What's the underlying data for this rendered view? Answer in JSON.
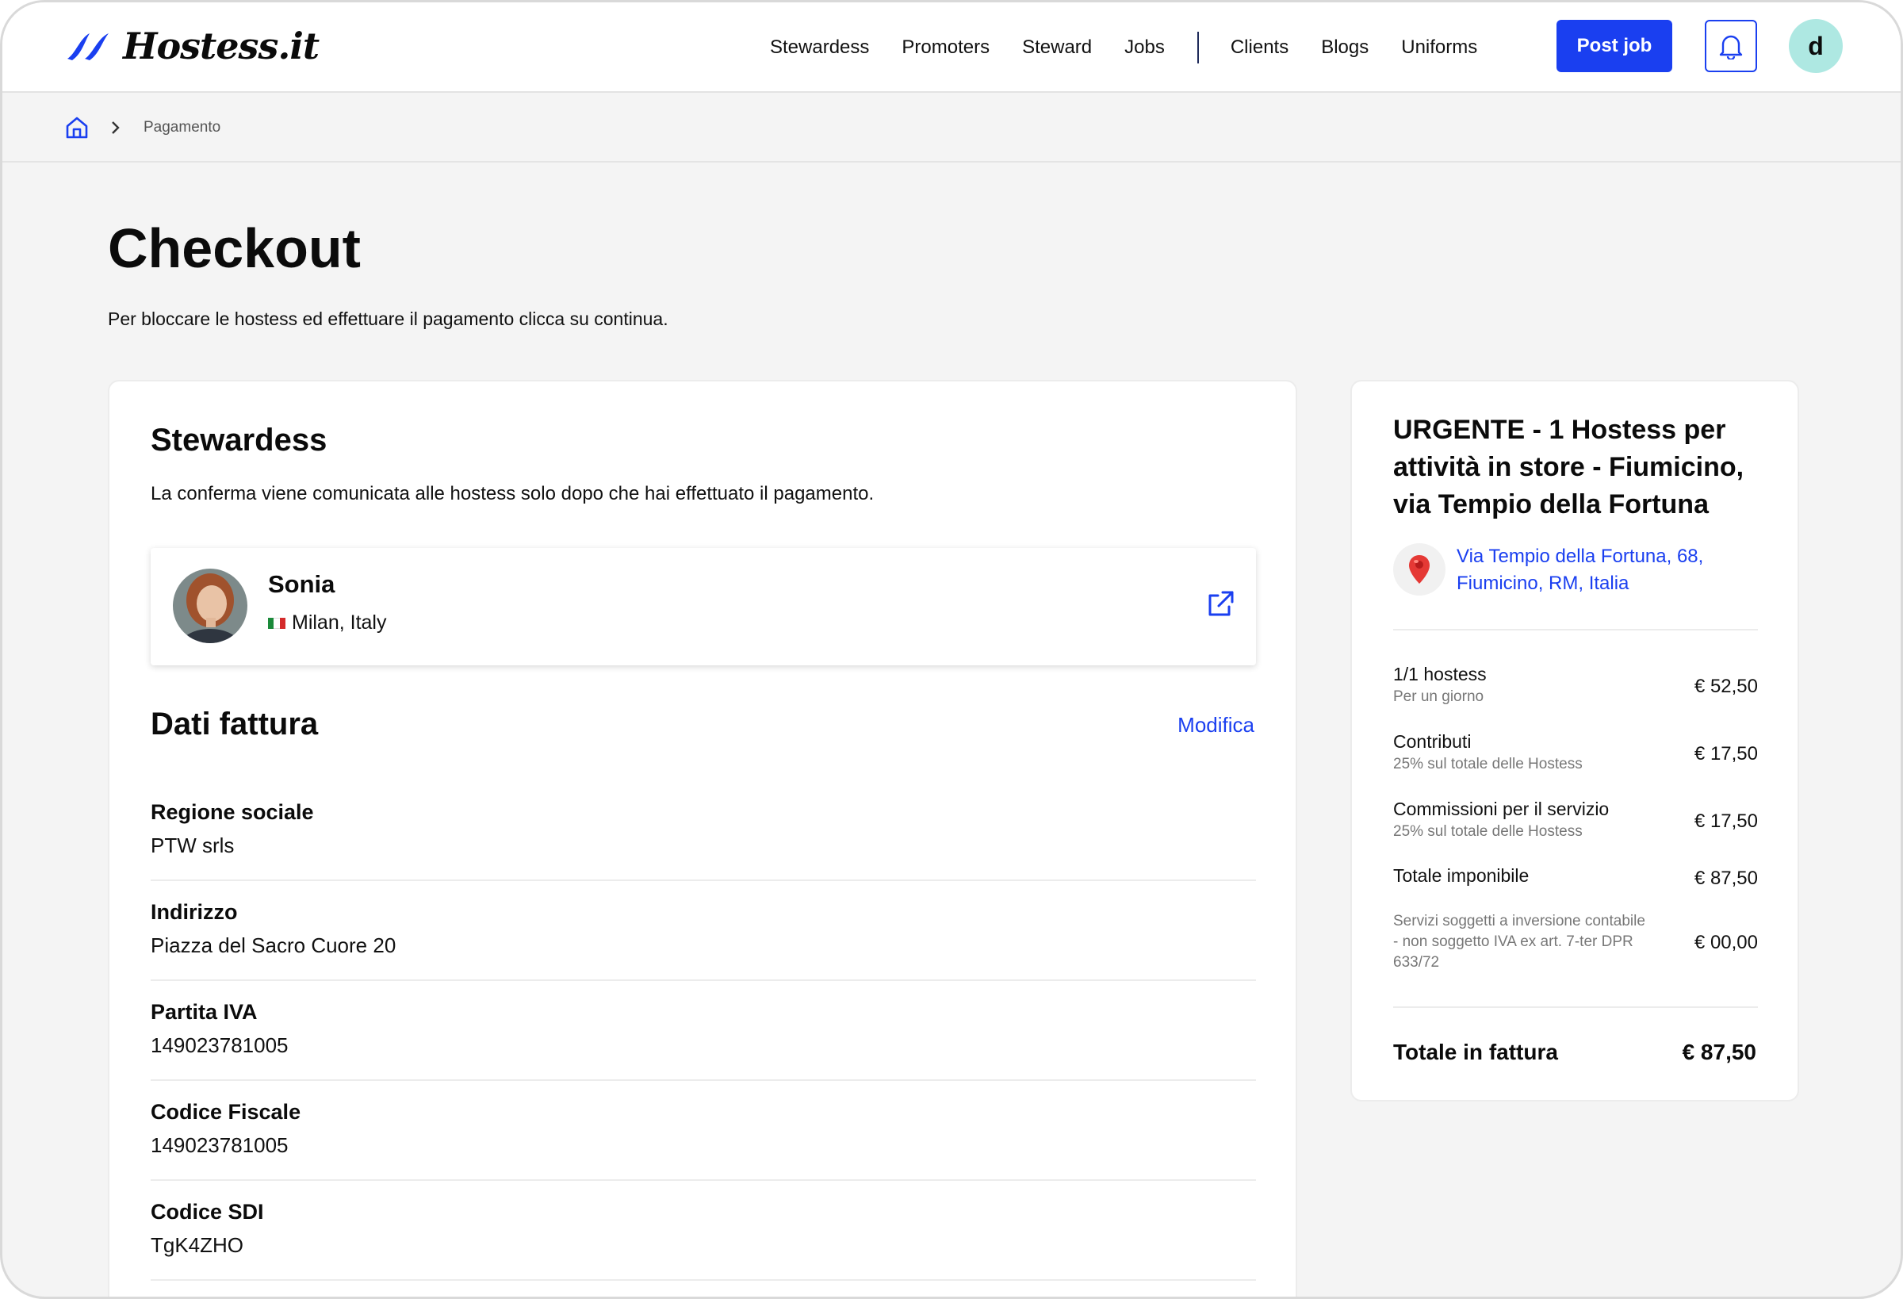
{
  "header": {
    "brand": "Hostess.it",
    "nav": [
      "Stewardess",
      "Promoters",
      "Steward",
      "Jobs"
    ],
    "nav_right": [
      "Clients",
      "Blogs",
      "Uniforms"
    ],
    "post_job_label": "Post job",
    "user_initial": "d",
    "accent_color": "#1a3ff0"
  },
  "breadcrumb": {
    "home_icon": "home-icon",
    "current": "Pagamento"
  },
  "page": {
    "title": "Checkout",
    "subtitle": "Per bloccare le hostess ed effettuare il pagamento clicca su continua."
  },
  "stewardess": {
    "title": "Stewardess",
    "description": "La conferma viene comunicata alle hostess solo dopo che hai effettuato il pagamento.",
    "person": {
      "name": "Sonia",
      "location": "Milan, Italy"
    }
  },
  "invoice": {
    "title": "Dati fattura",
    "edit_label": "Modifica",
    "fields": [
      {
        "label": "Regione sociale",
        "value": "PTW srls"
      },
      {
        "label": "Indirizzo",
        "value": "Piazza del Sacro Cuore 20"
      },
      {
        "label": "Partita IVA",
        "value": "149023781005"
      },
      {
        "label": "Codice Fiscale",
        "value": "149023781005"
      },
      {
        "label": "Codice SDI",
        "value": "TgK4ZHO"
      }
    ]
  },
  "summary": {
    "job_title": "URGENTE - 1 Hostess per attività in store - Fiumicino, via Tempio della Fortuna",
    "address_line1": "Via Tempio della Fortuna, 68,",
    "address_line2": "Fiumicino, RM, Italia",
    "lines": [
      {
        "label": "1/1 hostess",
        "sub": "Per un giorno",
        "value": "€ 52,50"
      },
      {
        "label": "Contributi",
        "sub": "25% sul totale delle Hostess",
        "value": "€ 17,50"
      },
      {
        "label": "Commissioni per il servizio",
        "sub": "25% sul totale delle Hostess",
        "value": "€ 17,50"
      },
      {
        "label": "Totale imponibile",
        "sub": "",
        "value": "€ 87,50"
      }
    ],
    "note": "Servizi soggetti a inversione contabile - non soggetto IVA ex art. 7-ter DPR 633/72",
    "note_value": "€ 00,00",
    "total_label": "Totale in fattura",
    "total_value": "€ 87,50"
  }
}
